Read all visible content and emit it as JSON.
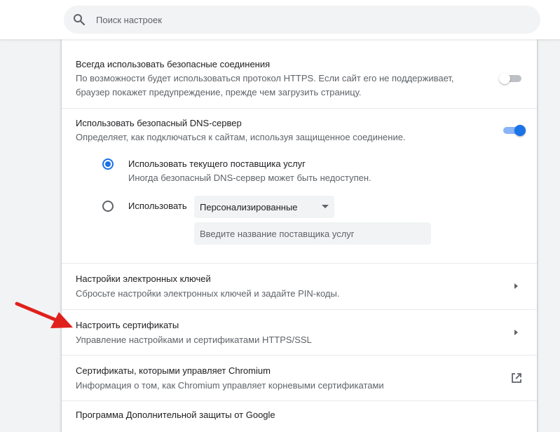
{
  "search": {
    "placeholder": "Поиск настроек",
    "icon": "search-icon"
  },
  "settings": {
    "https_only": {
      "title": "Всегда использовать безопасные соединения",
      "desc_line1": "По возможности будет использоваться протокол HTTPS. Если сайт его не поддерживает,",
      "desc_line2": "браузер покажет предупреждение, прежде чем загрузить страницу.",
      "enabled": false
    },
    "secure_dns": {
      "title": "Использовать безопасный DNS-сервер",
      "desc": "Определяет, как подключаться к сайтам, используя защищенное соединение.",
      "enabled": true,
      "option_current": {
        "label": "Использовать текущего поставщика услуг",
        "desc": "Иногда безопасный DNS-сервер может быть недоступен.",
        "checked": true
      },
      "option_custom": {
        "label": "Использовать",
        "checked": false,
        "select_value": "Персонализированные",
        "input_placeholder": "Введите название поставщика услуг"
      }
    },
    "security_keys": {
      "title": "Настройки электронных ключей",
      "desc": "Сбросьте настройки электронных ключей и задайте PIN-коды."
    },
    "certificates": {
      "title": "Настроить сертификаты",
      "desc": "Управление настройками и сертификатами HTTPS/SSL"
    },
    "chromium_certificates": {
      "title": "Сертификаты, которыми управляет Chromium",
      "desc": "Информация о том, как Chromium управляет корневыми сертификатами",
      "icon": "open-in-new-icon"
    },
    "advanced_protection": {
      "title": "Программа Дополнительной защиты от Google"
    }
  },
  "colors": {
    "accent": "#1a73e8",
    "annotation_arrow": "#e0201b"
  }
}
